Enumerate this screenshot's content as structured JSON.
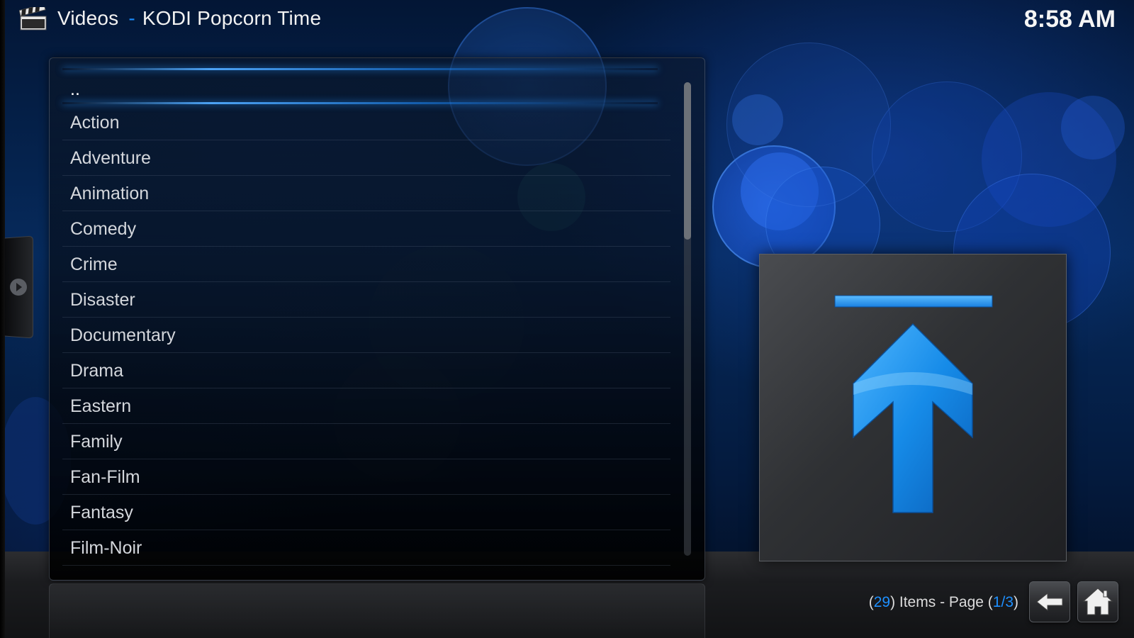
{
  "header": {
    "section": "Videos",
    "separator": "-",
    "addon": "KODI Popcorn Time",
    "icon": "clapperboard-icon"
  },
  "clock": "8:58 AM",
  "list": {
    "parent_item": "..",
    "items": [
      "Action",
      "Adventure",
      "Animation",
      "Comedy",
      "Crime",
      "Disaster",
      "Documentary",
      "Drama",
      "Eastern",
      "Family",
      "Fan-Film",
      "Fantasy",
      "Film-Noir"
    ]
  },
  "scroll": {
    "page_fraction": 0.333
  },
  "footer": {
    "item_count": "29",
    "items_text": "Items - Page",
    "page_current": "1",
    "page_total": "3",
    "page_sep": "/"
  },
  "preview": {
    "icon": "parent-folder-up-arrow-icon"
  },
  "nav": {
    "back_icon": "back-arrow-icon",
    "home_icon": "home-icon"
  },
  "colors": {
    "accent": "#1e90ff",
    "text": "#d4d7dc",
    "background": "#062a5c"
  }
}
